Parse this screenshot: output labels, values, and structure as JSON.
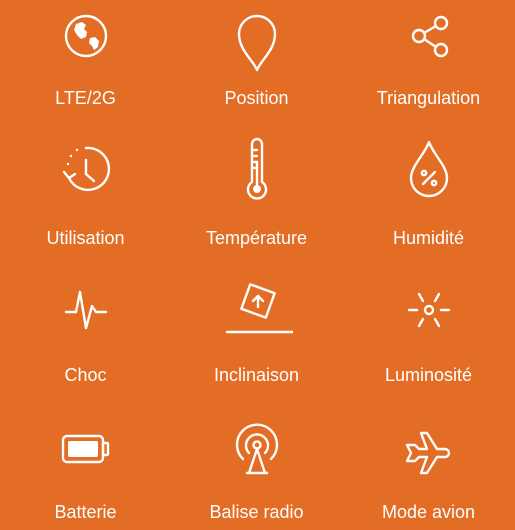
{
  "colors": {
    "background": "#e36d25",
    "foreground": "#ffffff"
  },
  "features": [
    {
      "label": "LTE/2G",
      "icon": "globe-icon"
    },
    {
      "label": "Position",
      "icon": "location-pin-icon"
    },
    {
      "label": "Triangulation",
      "icon": "share-nodes-icon"
    },
    {
      "label": "Utilisation",
      "icon": "clock-history-icon"
    },
    {
      "label": "Température",
      "icon": "thermometer-icon"
    },
    {
      "label": "Humidité",
      "icon": "humidity-drop-icon"
    },
    {
      "label": "Choc",
      "icon": "pulse-icon"
    },
    {
      "label": "Inclinaison",
      "icon": "tilt-icon"
    },
    {
      "label": "Luminosité",
      "icon": "brightness-icon"
    },
    {
      "label": "Batterie",
      "icon": "battery-icon"
    },
    {
      "label": "Balise radio",
      "icon": "radio-beacon-icon"
    },
    {
      "label": "Mode avion",
      "icon": "airplane-icon"
    }
  ]
}
